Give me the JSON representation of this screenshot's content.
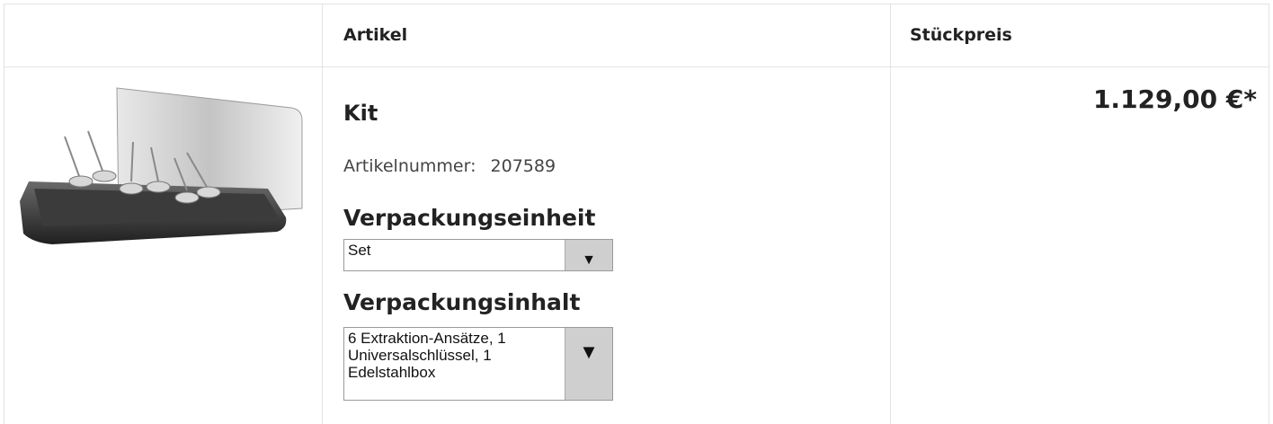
{
  "table": {
    "headers": {
      "article": "Artikel",
      "unit_price": "Stückpreis"
    }
  },
  "product": {
    "image_alt": "Kit",
    "title": "Kit",
    "article_number_label": "Artikelnummer:",
    "article_number": "207589",
    "packaging_unit_label": "Verpackungseinheit",
    "packaging_unit_value": "Set",
    "packaging_content_label": "Verpackungsinhalt",
    "packaging_content_value": "6 Extraktion-Ansätze, 1 Universalschlüssel, 1 Edelstahlbox",
    "price": "1.129,00 €*"
  },
  "icons": {
    "dropdown": "chevron-down-icon"
  }
}
